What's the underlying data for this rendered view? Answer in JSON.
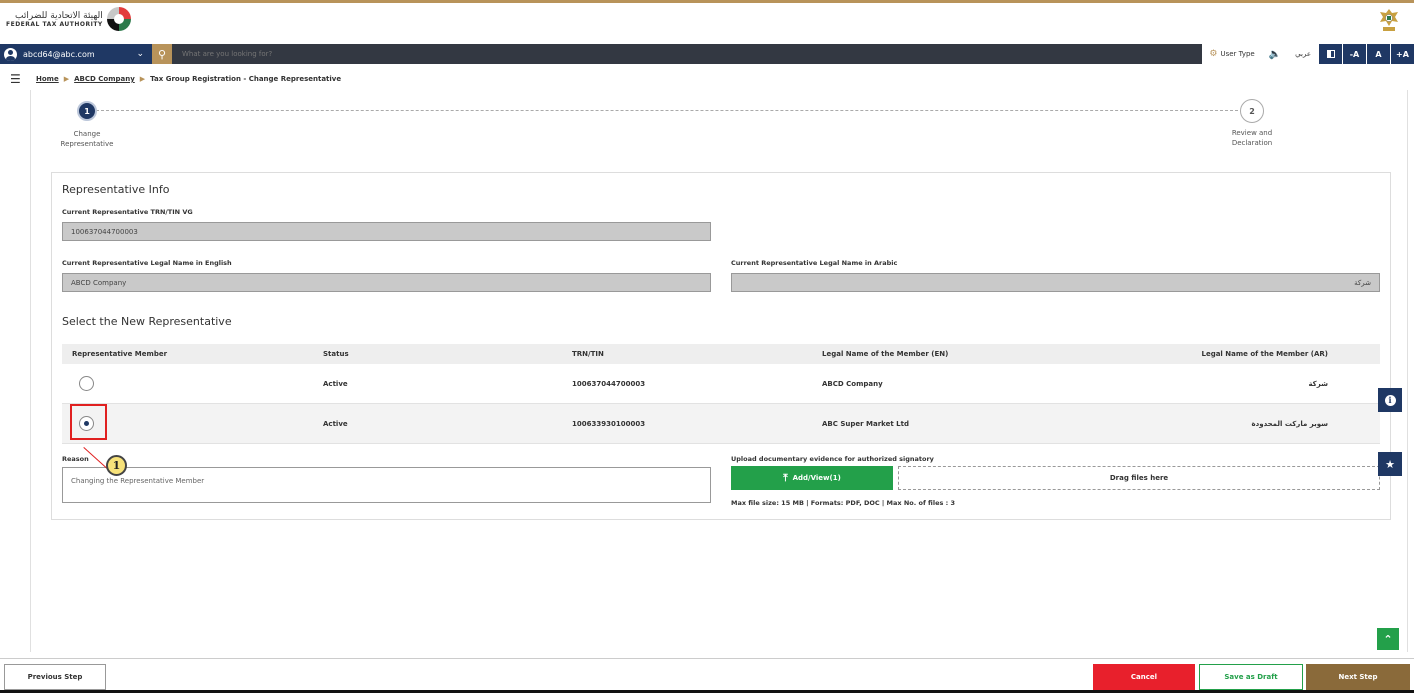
{
  "header": {
    "logo_ar": "الهيئة الاتحادية للضرائب",
    "logo_en": "FEDERAL TAX AUTHORITY"
  },
  "nav": {
    "user_email": "abcd64@abc.com",
    "search_placeholder": "What are you looking for?",
    "user_type_label": "User Type",
    "arabic_label": "عربي",
    "font_decrease": "-A",
    "font_normal": "A",
    "font_increase": "+A"
  },
  "breadcrumb": {
    "home": "Home",
    "company": "ABCD Company",
    "current": "Tax Group Registration - Change Representative"
  },
  "stepper": {
    "steps": [
      {
        "number": "1",
        "label_line1": "Change",
        "label_line2": "Representative",
        "state": "active"
      },
      {
        "number": "2",
        "label_line1": "Review and",
        "label_line2": "Declaration",
        "state": "todo"
      }
    ]
  },
  "rep_info": {
    "title": "Representative Info",
    "trn_label": "Current Representative TRN/TIN VG",
    "trn_value": "100637044700003",
    "name_en_label": "Current Representative Legal Name in English",
    "name_en_value": "ABCD Company",
    "name_ar_label": "Current Representative Legal Name in Arabic",
    "name_ar_value": "شركة"
  },
  "new_rep": {
    "title": "Select the New Representative",
    "columns": [
      "Representative Member",
      "Status",
      "TRN/TIN",
      "Legal Name of the Member (EN)",
      "Legal Name of the Member (AR)"
    ],
    "rows": [
      {
        "selected": false,
        "status": "Active",
        "trn": "100637044700003",
        "name_en": "ABCD Company",
        "name_ar": "شركة"
      },
      {
        "selected": true,
        "status": "Active",
        "trn": "100633930100003",
        "name_en": "ABC Super Market Ltd",
        "name_ar": "سوبر ماركت المحدودة"
      }
    ]
  },
  "annotation": {
    "number": "1"
  },
  "reason": {
    "label": "Reason",
    "value": "Changing the Representative Member"
  },
  "upload": {
    "label": "Upload documentary evidence for authorized signatory",
    "button": "Add/View(1)",
    "dropzone": "Drag files here",
    "hint": "Max file size: 15 MB  |  Formats: PDF, DOC  |  Max No. of files : 3"
  },
  "footer": {
    "previous": "Previous Step",
    "cancel": "Cancel",
    "save_draft": "Save as Draft",
    "next": "Next Step"
  },
  "colors": {
    "navy": "#1f3864",
    "gold": "#b8935a",
    "green": "#23a04a",
    "red": "#e8202c",
    "brown": "#8a6a3a"
  }
}
